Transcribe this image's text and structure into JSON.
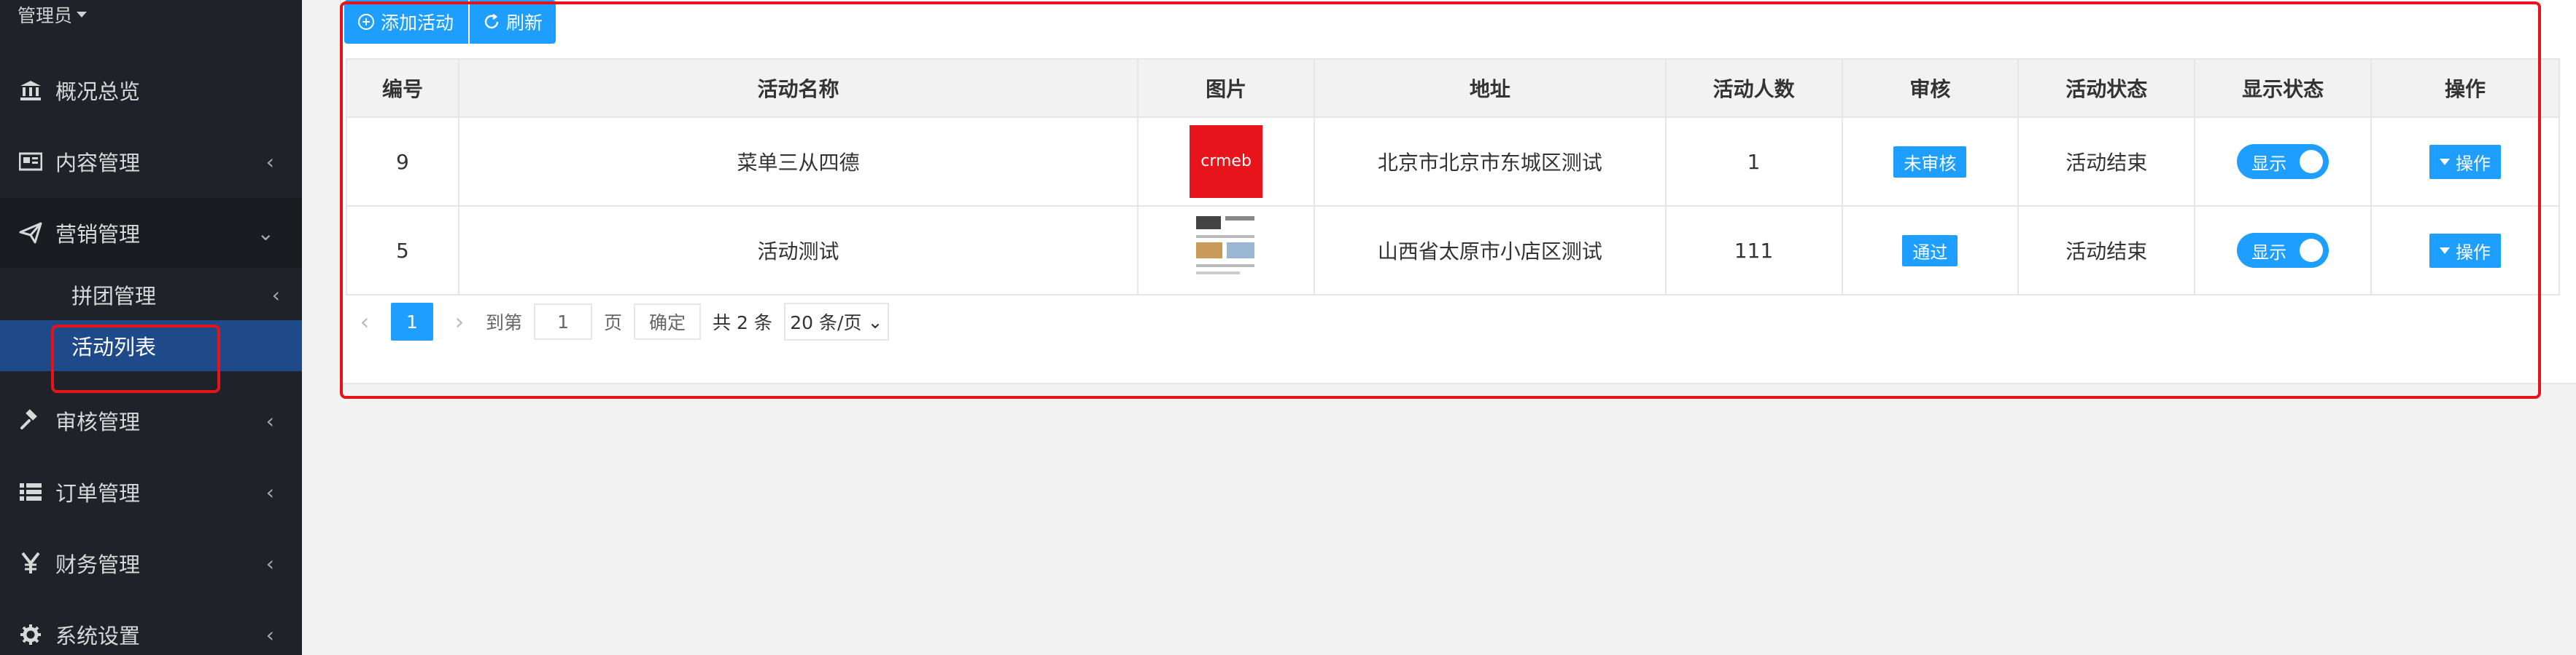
{
  "sidebar": {
    "admin_label": "管理员",
    "items": [
      {
        "label": "概况总览",
        "icon": "bank-icon"
      },
      {
        "label": "内容管理",
        "icon": "news-icon"
      },
      {
        "label": "营销管理",
        "icon": "paper-plane-icon"
      },
      {
        "label": "审核管理",
        "icon": "gavel-icon"
      },
      {
        "label": "订单管理",
        "icon": "list-icon"
      },
      {
        "label": "财务管理",
        "icon": "yen-icon"
      },
      {
        "label": "系统设置",
        "icon": "gear-icon"
      }
    ],
    "sub_items": [
      {
        "label": "拼团管理"
      },
      {
        "label": "活动列表"
      }
    ]
  },
  "toolbar": {
    "add_label": "添加活动",
    "refresh_label": "刷新"
  },
  "table": {
    "headers": [
      "编号",
      "活动名称",
      "图片",
      "地址",
      "活动人数",
      "审核",
      "活动状态",
      "显示状态",
      "操作"
    ],
    "rows": [
      {
        "id": "9",
        "name": "菜单三从四德",
        "image_text": "crmeb",
        "address": "北京市北京市东城区测试",
        "count": "1",
        "review": "未审核",
        "status": "活动结束",
        "display": "显示",
        "action": "操作"
      },
      {
        "id": "5",
        "name": "活动测试",
        "image_text": "",
        "address": "山西省太原市小店区测试",
        "count": "111",
        "review": "通过",
        "status": "活动结束",
        "display": "显示",
        "action": "操作"
      }
    ]
  },
  "pagination": {
    "current": "1",
    "goto_label": "到第",
    "goto_value": "1",
    "page_label": "页",
    "confirm_label": "确定",
    "total": "共 2 条",
    "page_size": "20 条/页"
  },
  "colors": {
    "primary": "#1e9fff",
    "sidebar_bg": "#20222a",
    "highlight": "#e5141b"
  }
}
